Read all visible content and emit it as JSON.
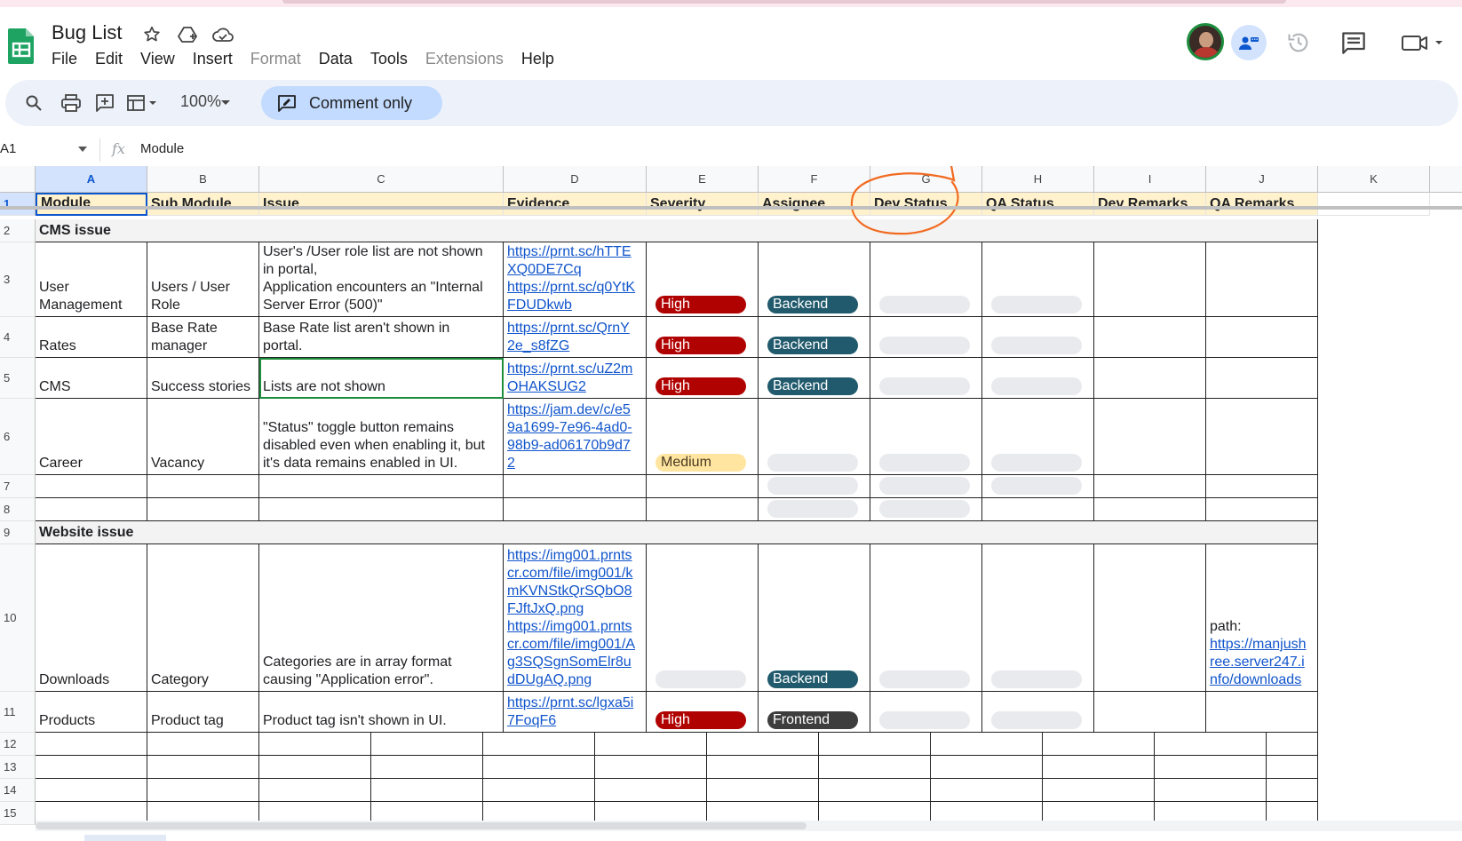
{
  "window": {
    "title": "Bug List",
    "menus": [
      "File",
      "Edit",
      "View",
      "Insert",
      "Format",
      "Data",
      "Tools",
      "Extensions",
      "Help"
    ],
    "dim_menus": [
      "Format",
      "Extensions"
    ]
  },
  "toolbar": {
    "zoom": "100%",
    "mode_label": "Comment only"
  },
  "formula_bar": {
    "name_box": "A1",
    "fx_label": "fx",
    "value": "Module"
  },
  "columns": [
    "A",
    "B",
    "C",
    "D",
    "E",
    "F",
    "G",
    "H",
    "I",
    "J",
    "K"
  ],
  "rows": [
    "1",
    "2",
    "3",
    "4",
    "5",
    "6",
    "7",
    "8",
    "9",
    "10",
    "11",
    "12",
    "13",
    "14",
    "15"
  ],
  "header": [
    "Module",
    "Sub Module",
    "Issue",
    "Evidence",
    "Severity",
    "Assignee",
    "Dev Status",
    "QA Status",
    "Dev Remarks",
    "QA Remarks"
  ],
  "sections": {
    "cms": "CMS issue",
    "website": "Website issue"
  },
  "data_rows": [
    {
      "row": "3",
      "module": "User\nManagement",
      "submodule": "Users / User\nRole",
      "issue": "User's /User role list are not shown\nin portal,\n Application encounters an \"Internal\nServer Error (500)\"",
      "evidence": "https://prnt.sc/hTTE\nXQ0DE7Cq\nhttps://prnt.sc/q0YtK\nFDUDkwb",
      "severity": "High",
      "assignee": "Backend"
    },
    {
      "row": "4",
      "module": "Rates",
      "submodule": "Base Rate\nmanager",
      "issue": "Base Rate list aren't shown in\nportal.",
      "evidence": "https://prnt.sc/QrnY\n2e_s8fZG",
      "severity": "High",
      "assignee": "Backend"
    },
    {
      "row": "5",
      "module": "CMS",
      "submodule": "Success stories",
      "issue": "Lists are not shown",
      "evidence": "https://prnt.sc/uZ2m\nOHAKSUG2",
      "severity": "High",
      "assignee": "Backend"
    },
    {
      "row": "6",
      "module": "Career",
      "submodule": "Vacancy",
      "issue": "\"Status\" toggle button remains\ndisabled even when enabling it, but\nit's data remains enabled in UI.",
      "evidence": "https://jam.dev/c/e5\n9a1699-7e96-4ad0-\n98b9-ad06170b9d7\n2",
      "severity": "Medium",
      "assignee": ""
    },
    {
      "row": "10",
      "module": "Downloads",
      "submodule": "Category",
      "issue": "Categories are in array format\ncausing \"Application error\".",
      "evidence": "https://img001.prnts\ncr.com/file/img001/k\nmKVNStkQrSQbO8\nFJftJxQ.png\nhttps://img001.prnts\ncr.com/file/img001/A\ng3SQSgnSomElr8u\ndDUgAQ.png",
      "severity": "",
      "assignee": "Backend",
      "qa_remarks_label": "path:",
      "qa_remarks_link": "https://manjush\nree.server247.i\nnfo/downloads"
    },
    {
      "row": "11",
      "module": "Products",
      "submodule": "Product tag",
      "issue": "Product tag isn't shown in UI.",
      "evidence": "https://prnt.sc/lgxa5i\n7FoqF6",
      "severity": "High",
      "assignee": "Frontend"
    }
  ],
  "colors": {
    "header_fill": "#fff2cc",
    "high_chip": "#b10202",
    "medium_chip": "#ffe5a0",
    "backend_chip": "#215a6c",
    "frontend_chip": "#3d3d3d",
    "annotation": "#f26b21",
    "link": "#1155cc"
  }
}
